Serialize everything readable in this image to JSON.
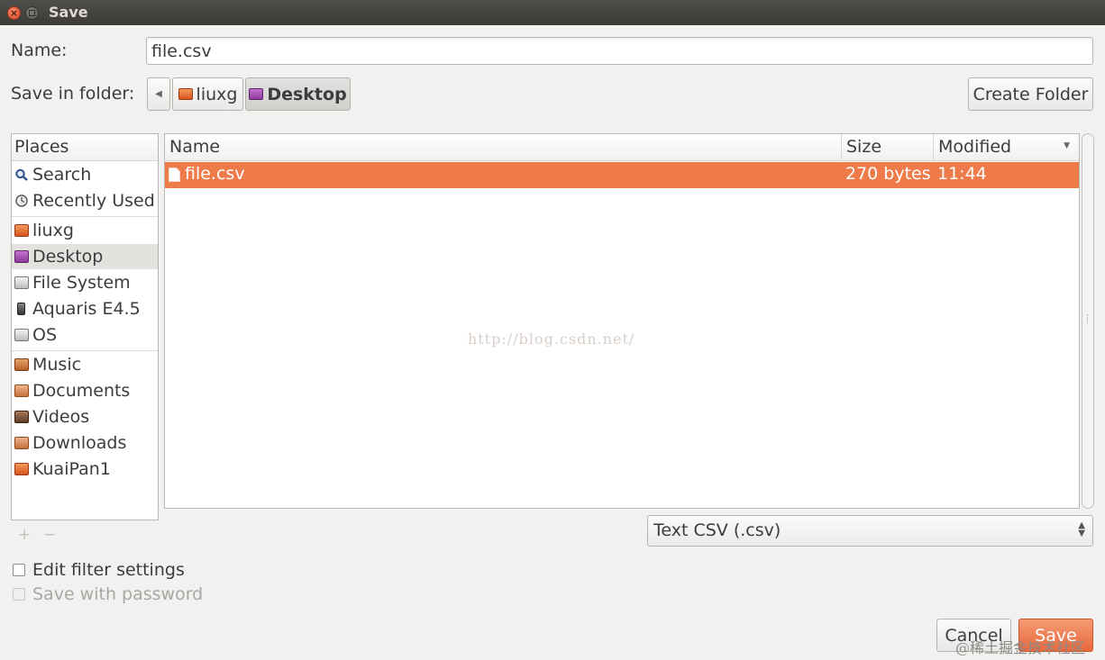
{
  "window": {
    "title": "Save"
  },
  "name_field": {
    "label": "Name:",
    "value": "file.csv"
  },
  "folder": {
    "label": "Save in folder:",
    "breadcrumbs": [
      "liuxg",
      "Desktop"
    ],
    "create_folder_label": "Create Folder"
  },
  "places": {
    "header": "Places",
    "items": [
      {
        "label": "Search",
        "icon": "search-icon"
      },
      {
        "label": "Recently Used",
        "icon": "recent-icon"
      },
      {
        "label": "liuxg",
        "icon": "home-folder-icon"
      },
      {
        "label": "Desktop",
        "icon": "desktop-folder-icon",
        "selected": true
      },
      {
        "label": "File System",
        "icon": "drive-icon"
      },
      {
        "label": "Aquaris E4.5",
        "icon": "phone-icon"
      },
      {
        "label": "OS",
        "icon": "drive-icon"
      },
      {
        "label": "Music",
        "icon": "music-folder-icon"
      },
      {
        "label": "Documents",
        "icon": "documents-folder-icon"
      },
      {
        "label": "Videos",
        "icon": "videos-folder-icon"
      },
      {
        "label": "Downloads",
        "icon": "downloads-folder-icon"
      },
      {
        "label": "KuaiPan1",
        "icon": "folder-icon"
      }
    ],
    "add_symbol": "+",
    "remove_symbol": "−"
  },
  "files": {
    "columns": [
      "Name",
      "Size",
      "Modified"
    ],
    "rows": [
      {
        "name": "file.csv",
        "size": "270 bytes",
        "modified": "11:44",
        "selected": true
      }
    ],
    "watermark": "http://blog.csdn.net/"
  },
  "filter": {
    "value": "Text CSV (.csv)"
  },
  "options": {
    "edit_filter": "Edit filter settings",
    "save_password": "Save with password"
  },
  "buttons": {
    "cancel": "Cancel",
    "save": "Save"
  },
  "corner_watermark": "@稀土掘金技术社区",
  "colors": {
    "accent": "#ef7a4a",
    "titlebar": "#3c3b37"
  }
}
